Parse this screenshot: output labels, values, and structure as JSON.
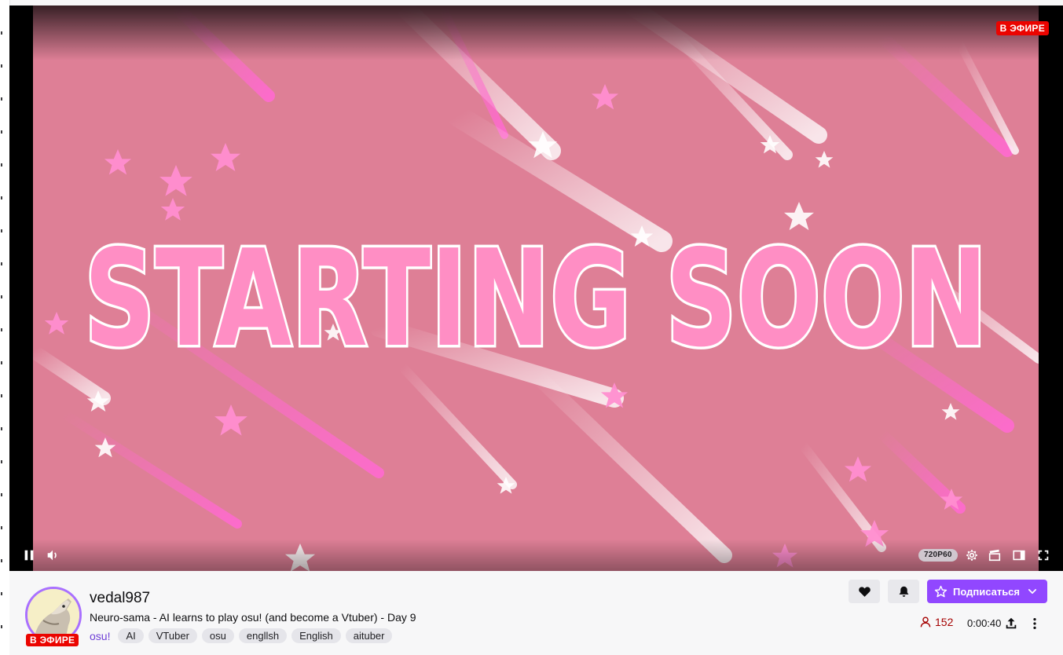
{
  "player": {
    "live_badge": "В ЭФИРЕ",
    "overlay_text": "STARTING SOON",
    "quality": "720P60",
    "icons": {
      "pause": "pause-icon",
      "volume": "volume-icon",
      "settings": "gear-icon",
      "clip": "clapper-icon",
      "theatre": "theatre-mode-icon",
      "fullscreen": "fullscreen-icon"
    }
  },
  "channel": {
    "name": "vedal987",
    "title": "Neuro-sama - AI learns to play osu! (and become a Vtuber) - Day 9",
    "category": "osu!",
    "tags": [
      "AI",
      "VTuber",
      "osu",
      "engllsh",
      "English",
      "aituber"
    ],
    "live_badge": "В ЭФИРЕ",
    "viewers": "152",
    "uptime": "0:00:40"
  },
  "actions": {
    "subscribe_label": "Подписаться",
    "icons": {
      "follow": "heart-icon",
      "notify": "bell-icon",
      "subscribe": "star-icon",
      "subscribe_menu": "chevron-down-icon",
      "share": "share-icon",
      "more": "more-vertical-icon"
    }
  },
  "colors": {
    "accent": "#9147ff",
    "live": "#eb0400",
    "video_bg": "#de7f96",
    "viewers": "#a50000"
  }
}
